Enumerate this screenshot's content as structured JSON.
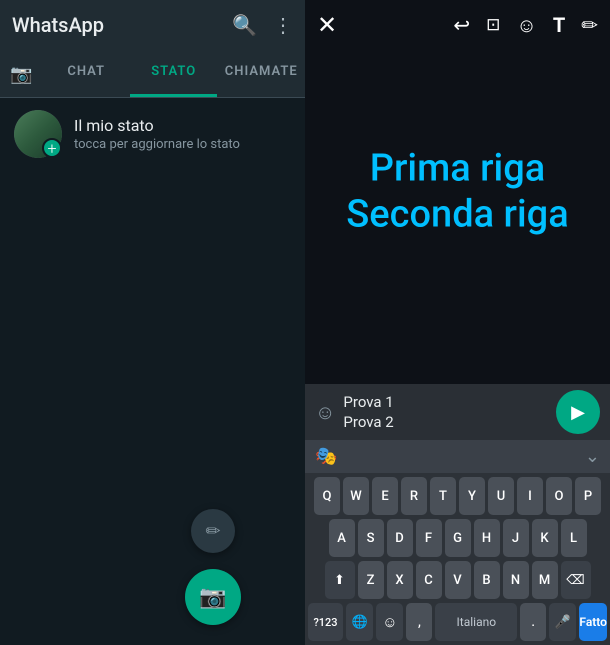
{
  "left": {
    "app_title": "WhatsApp",
    "top_icons": [
      "search",
      "more"
    ],
    "tabs": [
      {
        "label": "CHAT",
        "active": false
      },
      {
        "label": "STATO",
        "active": true
      },
      {
        "label": "CHIAMATE",
        "active": false
      }
    ],
    "status": {
      "name": "Il mio stato",
      "subtitle": "tocca per aggiornare lo stato"
    }
  },
  "right": {
    "top_icons": {
      "close": "✕",
      "undo": "↩",
      "crop": "⊡",
      "emoji": "☺",
      "text": "T",
      "draw": "✏"
    },
    "canvas_text_line1": "Prima riga",
    "canvas_text_line2": "Seconda riga",
    "autocomplete": {
      "suggestions": [
        "Prova 1",
        "Prova 2"
      ]
    },
    "keyboard": {
      "rows": [
        [
          "Q",
          "W",
          "E",
          "R",
          "T",
          "Y",
          "U",
          "I",
          "O",
          "P"
        ],
        [
          "A",
          "S",
          "D",
          "F",
          "G",
          "H",
          "J",
          "K",
          "L"
        ],
        [
          "Z",
          "X",
          "C",
          "V",
          "B",
          "N",
          "M"
        ],
        [
          "?123",
          "globe",
          "emoji",
          ",",
          "space",
          ".",
          "mic",
          "Fatto"
        ]
      ],
      "space_label": "Italiano",
      "fatto_label": "Fatto"
    }
  }
}
